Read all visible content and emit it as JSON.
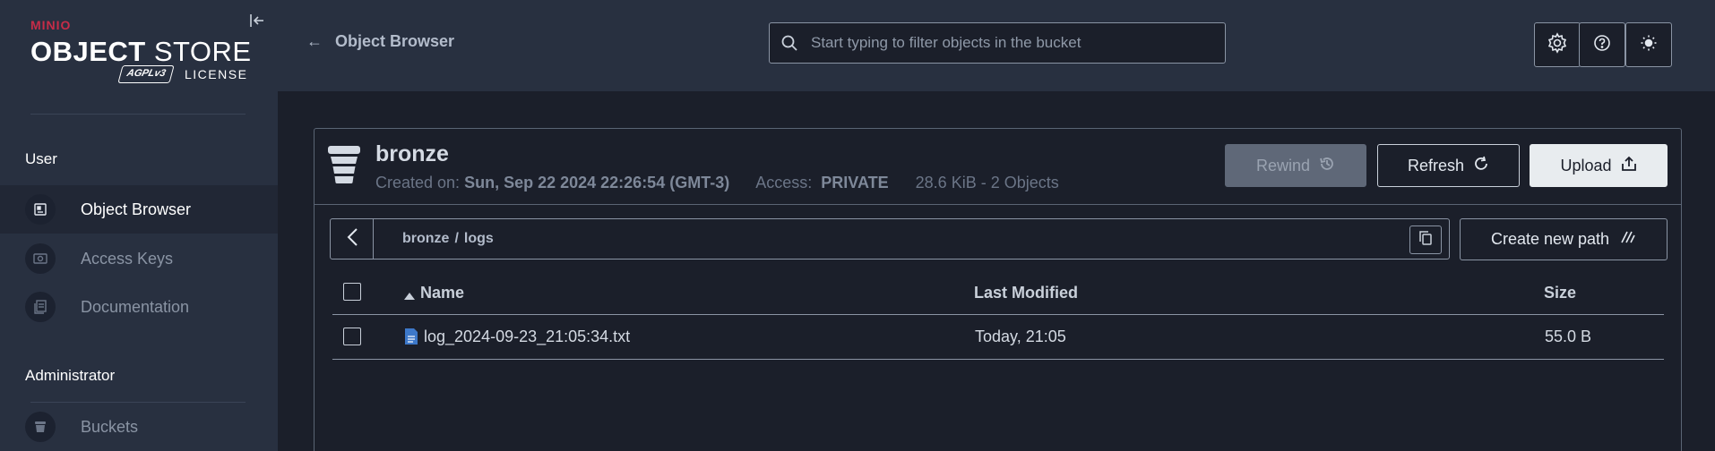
{
  "sidebar": {
    "logo": {
      "brand": "MINIO",
      "title_bold": "OBJECT",
      "title_light": " STORE",
      "license_badge": "AGPLv3",
      "license_text": "LICENSE"
    },
    "sections": [
      {
        "label": "User",
        "items": [
          {
            "label": "Object Browser",
            "icon": "object-browser-icon",
            "active": true
          },
          {
            "label": "Access Keys",
            "icon": "access-keys-icon",
            "active": false
          },
          {
            "label": "Documentation",
            "icon": "documentation-icon",
            "active": false
          }
        ]
      },
      {
        "label": "Administrator",
        "items": [
          {
            "label": "Buckets",
            "icon": "bucket-icon",
            "active": false
          }
        ]
      }
    ]
  },
  "header": {
    "back_label": "Object Browser",
    "search_placeholder": "Start typing to filter objects in the bucket",
    "buttons": [
      "settings-icon",
      "help-icon",
      "theme-toggle-icon"
    ]
  },
  "bucket": {
    "name": "bronze",
    "created_label": "Created on:",
    "created_value": "Sun, Sep 22 2024 22:26:54 (GMT-3)",
    "access_label": "Access:",
    "access_value": "PRIVATE",
    "usage": "28.6 KiB - 2 Objects",
    "actions": {
      "rewind": "Rewind",
      "refresh": "Refresh",
      "upload": "Upload"
    }
  },
  "breadcrumb": {
    "root": "bronze",
    "separator": "/",
    "current": "logs"
  },
  "create_path_label": "Create new path",
  "table": {
    "columns": {
      "name": "Name",
      "modified": "Last Modified",
      "size": "Size"
    },
    "rows": [
      {
        "name": "log_2024-09-23_21:05:34.txt",
        "modified": "Today, 21:05",
        "size": "55.0 B"
      }
    ]
  },
  "colors": {
    "sidebar_bg": "#283040",
    "page_bg": "#1b1f2a",
    "brand_red": "#c72c48",
    "file_icon": "#3d78c9"
  }
}
